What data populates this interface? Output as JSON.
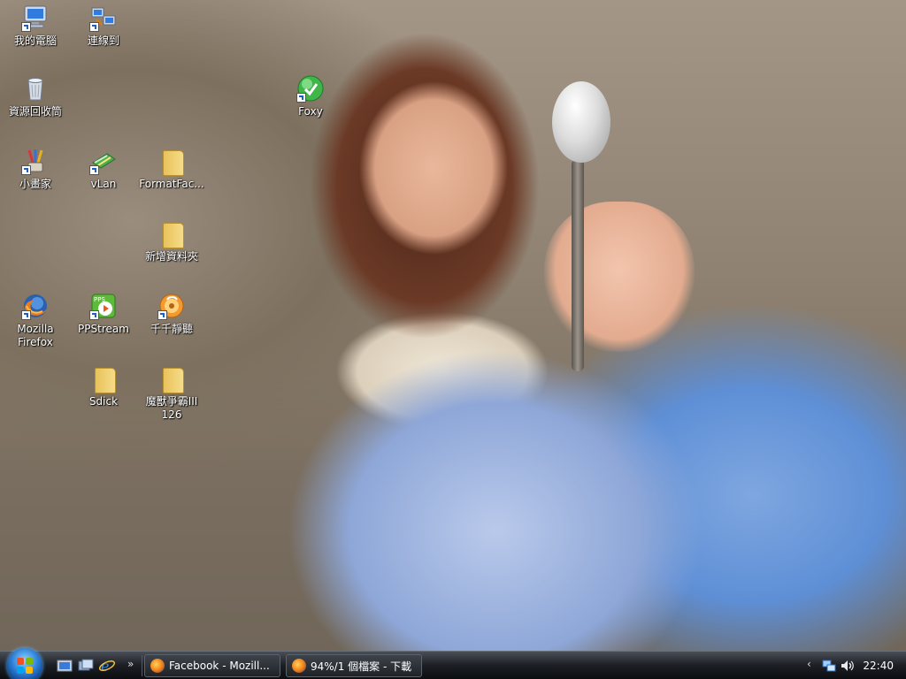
{
  "desktop": {
    "icons": [
      {
        "label": "我的電腦",
        "icon": "computer-icon"
      },
      {
        "label": "連線到",
        "icon": "network-connect-icon"
      },
      {
        "label": "資源回收筒",
        "icon": "recycle-bin-icon"
      },
      {
        "label": "Foxy",
        "icon": "foxy-icon"
      },
      {
        "label": "小畫家",
        "icon": "paint-icon"
      },
      {
        "label": "vLan",
        "icon": "vlan-icon"
      },
      {
        "label": "FormatFac...",
        "icon": "folder-icon"
      },
      {
        "label": "新增資料夾",
        "icon": "folder-icon"
      },
      {
        "label": "Mozilla\nFirefox",
        "icon": "firefox-icon"
      },
      {
        "label": "PPStream",
        "icon": "ppstream-icon"
      },
      {
        "label": "千千靜聽",
        "icon": "music-player-icon"
      },
      {
        "label": "Sdick",
        "icon": "folder-icon"
      },
      {
        "label": "魔獸爭霸III\n126",
        "icon": "folder-icon"
      }
    ],
    "ppstream_badge": "PPS"
  },
  "taskbar": {
    "start_button": "windows-orb-icon",
    "quick_launch": [
      "show-desktop-icon",
      "switch-windows-icon",
      "internet-explorer-icon"
    ],
    "overflow_glyph": "»",
    "tasks": [
      {
        "label": "Facebook - Mozill...",
        "icon": "firefox-icon"
      },
      {
        "label": "94%/1 個檔案 - 下載",
        "icon": "firefox-icon"
      }
    ],
    "tray": {
      "expand_glyph": "‹",
      "icons": [
        "network-icon",
        "volume-icon"
      ],
      "clock": "22:40"
    }
  },
  "colors": {
    "taskbar": "#1c1f24",
    "label_text": "#ffffff",
    "folder": "#f0d070"
  }
}
